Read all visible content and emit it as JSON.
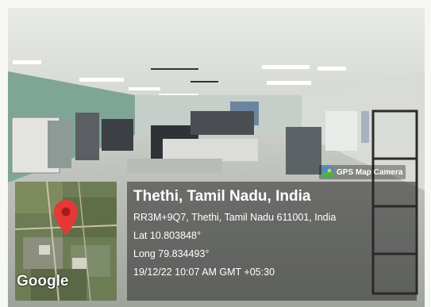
{
  "badge": {
    "label": "GPS Map Camera",
    "icon": "gps-map-camera-icon"
  },
  "location": {
    "title": "Thethi, Tamil Nadu, India",
    "address": "RR3M+9Q7, Thethi, Tamil Nadu 611001, India",
    "lat": "Lat 10.803848°",
    "long": "Long 79.834493°",
    "datetime": "19/12/22 10:07 AM GMT +05:30"
  },
  "map": {
    "brand": "Google",
    "marker_color": "#e53935",
    "icon": "map-pin-icon"
  },
  "colors": {
    "overlay": "#282828",
    "text": "#ffffff"
  }
}
